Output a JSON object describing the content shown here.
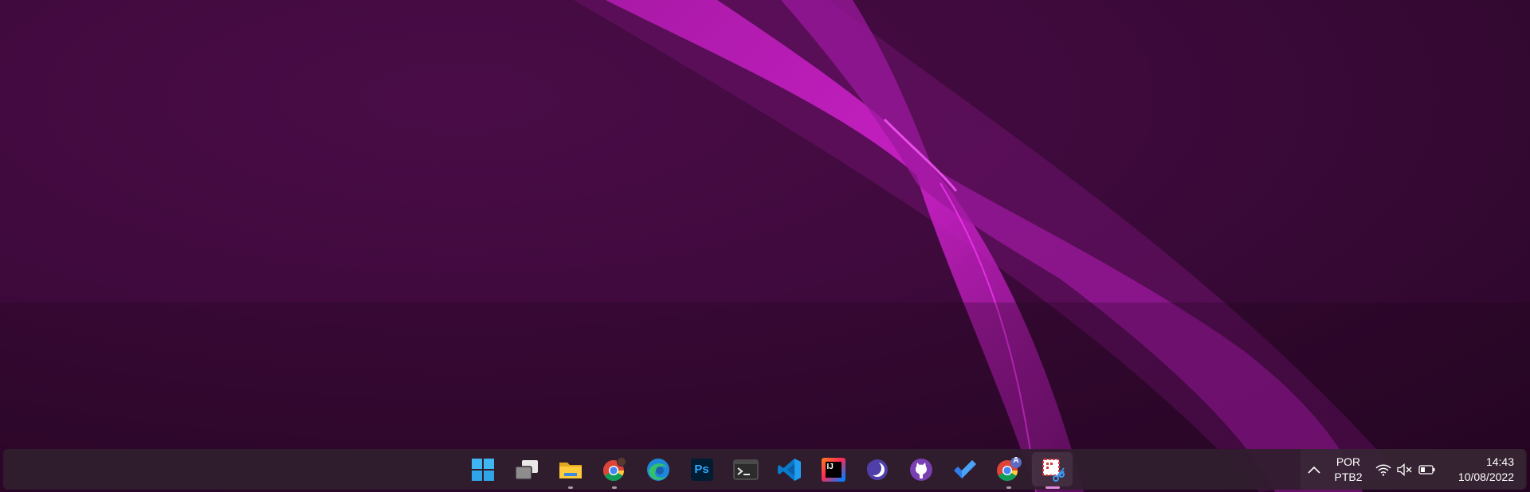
{
  "desktop": {
    "background_color": "#3f0a3d",
    "accent_color": "#e01fe0"
  },
  "taskbar": {
    "apps": [
      {
        "name": "start-button",
        "icon": "windows-logo-icon",
        "running": false,
        "active": false
      },
      {
        "name": "task-view-button",
        "icon": "task-view-icon",
        "running": false,
        "active": false
      },
      {
        "name": "file-explorer-button",
        "icon": "folder-icon",
        "running": true,
        "active": false
      },
      {
        "name": "chrome-profile-button",
        "icon": "chrome-icon",
        "running": true,
        "active": false
      },
      {
        "name": "edge-button",
        "icon": "edge-icon",
        "running": false,
        "active": false
      },
      {
        "name": "photoshop-button",
        "icon": "photoshop-icon",
        "running": false,
        "active": false
      },
      {
        "name": "terminal-button",
        "icon": "terminal-icon",
        "running": false,
        "active": false
      },
      {
        "name": "vscode-button",
        "icon": "vscode-icon",
        "running": false,
        "active": false
      },
      {
        "name": "intellij-button",
        "icon": "intellij-icon",
        "running": false,
        "active": false
      },
      {
        "name": "eclipse-button",
        "icon": "eclipse-icon",
        "running": false,
        "active": false
      },
      {
        "name": "github-desktop-button",
        "icon": "github-icon",
        "running": false,
        "active": false
      },
      {
        "name": "todo-button",
        "icon": "checkmark-icon",
        "running": false,
        "active": false
      },
      {
        "name": "chrome-profile-a-button",
        "icon": "chrome-icon",
        "running": true,
        "active": false
      },
      {
        "name": "snipping-tool-button",
        "icon": "snipping-tool-icon",
        "running": true,
        "active": true
      }
    ],
    "photoshop_label": "Ps",
    "intellij_label": "IJ",
    "chrome_profile_badge": "A"
  },
  "tray": {
    "chevron_icon": "chevron-up-icon",
    "language": "POR",
    "keyboard_layout": "PTB2",
    "wifi_icon": "wifi-icon",
    "volume_icon": "volume-muted-icon",
    "battery_icon": "battery-icon",
    "time": "14:43",
    "date": "10/08/2022"
  }
}
